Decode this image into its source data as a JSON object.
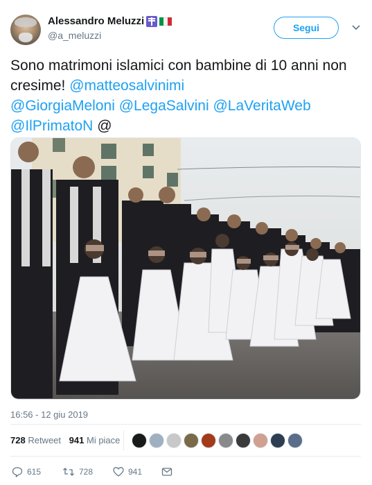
{
  "author": {
    "display_name": "Alessandro Meluzzi",
    "handle": "@a_meluzzi",
    "badges": [
      "orthodox-cross-icon",
      "italy-flag-icon"
    ]
  },
  "follow_button": {
    "label": "Segui"
  },
  "tweet": {
    "text_plain": "Sono matrimoni islamici con bambine di 10 anni non cresime! ",
    "mentions": [
      "@matteosalvinimi",
      "@GiorgiaMeloni",
      "@LegaSalvini",
      "@LaVeritaWeb",
      "@IlPrimatoN"
    ],
    "trailing": "@"
  },
  "photo": {
    "alt_icon": "wedding-photo"
  },
  "timestamp": "16:56 - 12 giu 2019",
  "stats": {
    "retweets_count": "728",
    "retweets_label": "Retweet",
    "likes_count": "941",
    "likes_label": "Mi piace"
  },
  "liker_avatars": [
    {
      "color": "#1a1a1a"
    },
    {
      "color": "#9fb0c0"
    },
    {
      "color": "#c8c8c8"
    },
    {
      "color": "#7a6a4a"
    },
    {
      "color": "#a33a1a"
    },
    {
      "color": "#8a8a8a"
    },
    {
      "color": "#3a3a3a"
    },
    {
      "color": "#d0a090"
    },
    {
      "color": "#2c3e50"
    },
    {
      "color": "#5a6e8a"
    }
  ],
  "actions": {
    "reply_count": "615",
    "retweet_count": "728",
    "like_count": "941"
  },
  "colors": {
    "accent": "#1da1f2",
    "text": "#14171a",
    "muted": "#657786"
  }
}
